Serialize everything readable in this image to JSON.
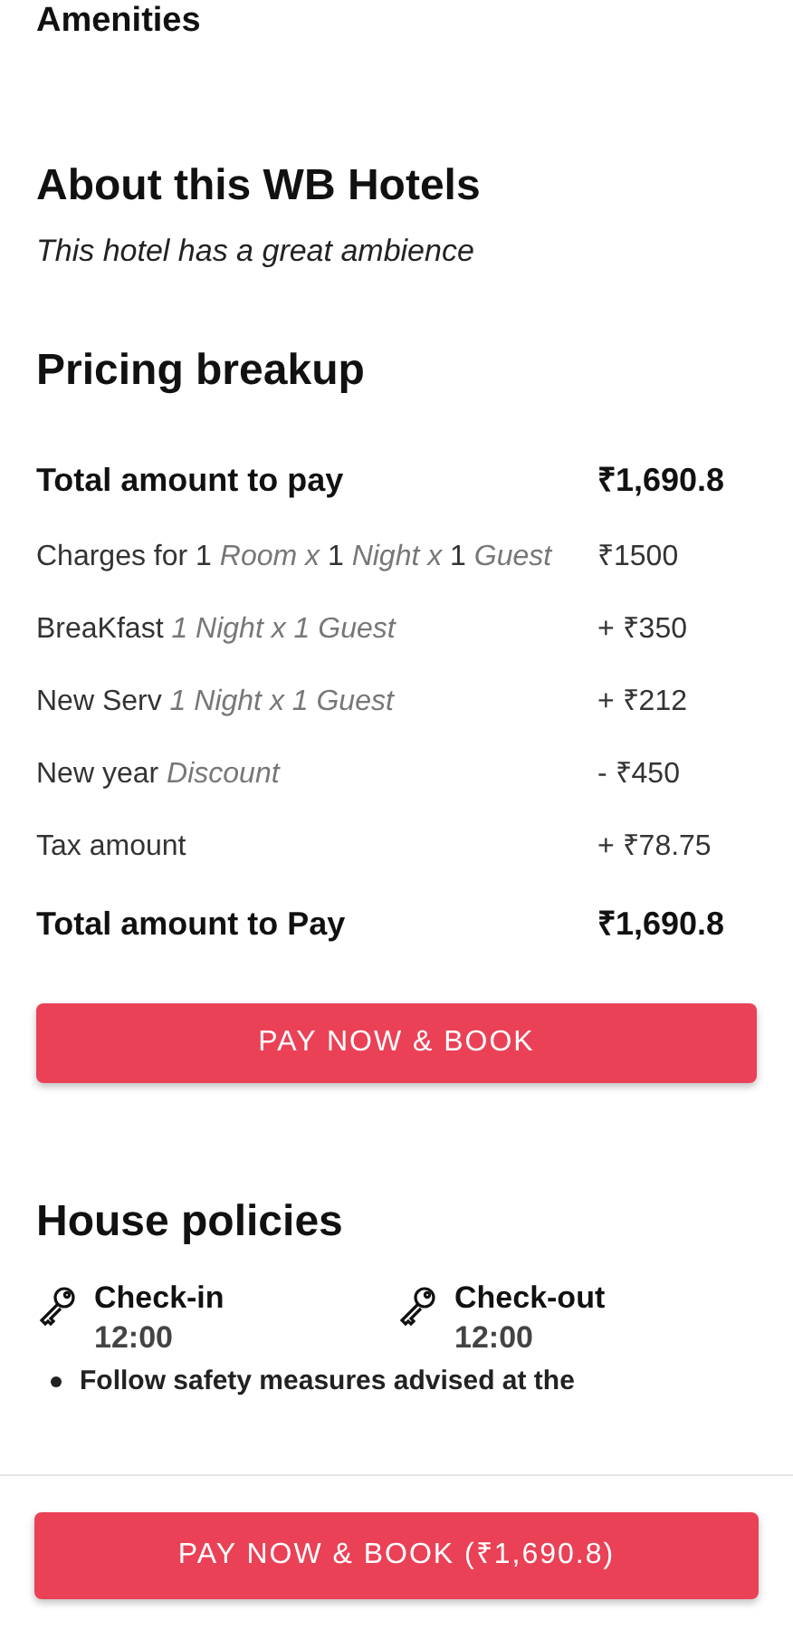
{
  "amenities_heading": "Amenities",
  "about": {
    "title": "About this WB Hotels",
    "description": "This hotel has a great ambience"
  },
  "pricing": {
    "title": "Pricing breakup",
    "rows": [
      {
        "kind": "total",
        "label": "Total amount to pay",
        "amount": "₹1,690.8"
      },
      {
        "kind": "item",
        "label": "Charges for 1 *Room x* 1 *Night x* 1 *Guest*",
        "amount": "₹1500"
      },
      {
        "kind": "item",
        "label": "BreaKfast *1 Night x 1 Guest*",
        "amount": "+ ₹350"
      },
      {
        "kind": "item",
        "label": "New Serv *1 Night x 1 Guest*",
        "amount": "+ ₹212"
      },
      {
        "kind": "item",
        "label": "New year *Discount*",
        "amount": "- ₹450"
      },
      {
        "kind": "item",
        "label": "Tax amount",
        "amount": "+ ₹78.75"
      },
      {
        "kind": "total",
        "label": "Total amount to Pay",
        "amount": "₹1,690.8"
      }
    ],
    "button": "PAY NOW & BOOK"
  },
  "policies": {
    "title": "House policies",
    "times": [
      {
        "label": "Check-in",
        "time": "12:00"
      },
      {
        "label": "Check-out",
        "time": "12:00"
      }
    ],
    "rules": [
      "Follow safety measures advised at the"
    ]
  },
  "bottom_button": "PAY NOW & BOOK (₹1,690.8)"
}
